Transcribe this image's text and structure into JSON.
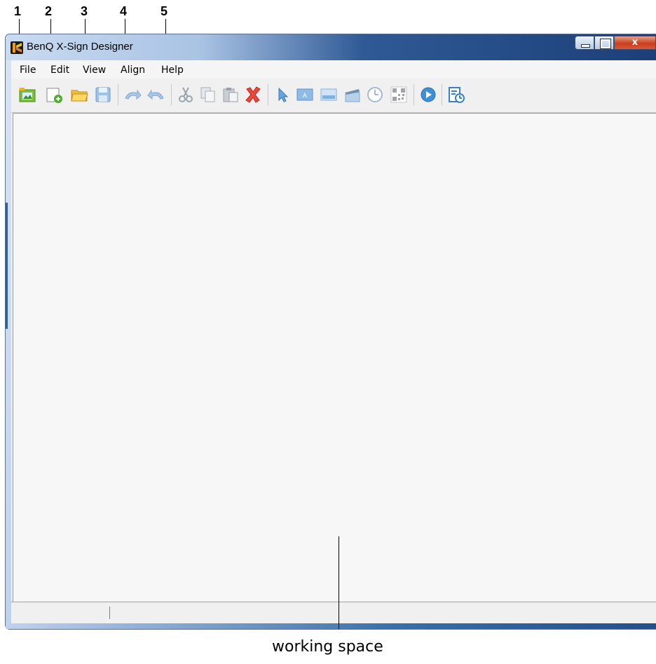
{
  "callouts": [
    "1",
    "2",
    "3",
    "4",
    "5"
  ],
  "window": {
    "title": "BenQ X-Sign Designer"
  },
  "menu": {
    "items": [
      "File",
      "Edit",
      "View",
      "Align",
      "Help"
    ]
  },
  "toolbar": {
    "buttons": [
      "image-library-icon",
      "new-project-icon",
      "open-folder-icon",
      "save-icon",
      "redo-icon",
      "undo-icon",
      "cut-icon",
      "copy-icon",
      "paste-icon",
      "delete-icon",
      "select-pointer-icon",
      "text-box-icon",
      "image-icon",
      "video-icon",
      "clock-icon",
      "qr-code-icon",
      "play-preview-icon",
      "schedule-icon"
    ]
  },
  "annotation": {
    "caption": "working space"
  },
  "colors": {
    "titlebar": "#1c3f78",
    "accent": "#2f5f9a",
    "close": "#c7401d"
  }
}
